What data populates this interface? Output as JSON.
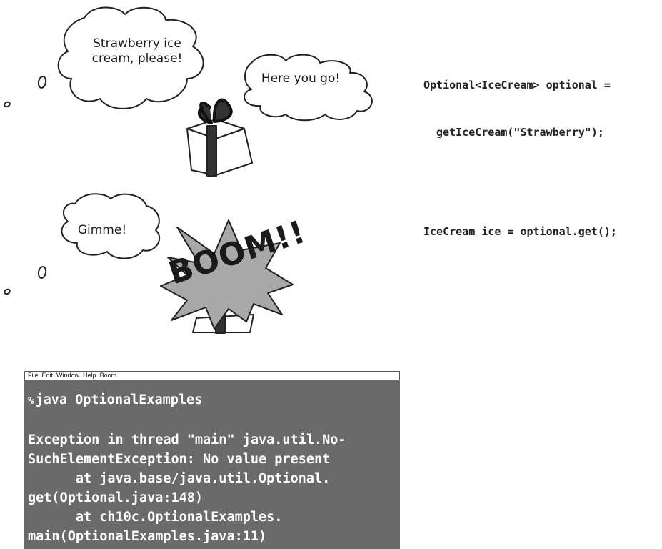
{
  "panel1": {
    "speech_customer": [
      "Strawberry ice",
      "cream, please!"
    ],
    "speech_clerk": "Here you go!",
    "code": [
      "Optional<IceCream> optional =",
      "  getIceCream(\"Strawberry\");"
    ]
  },
  "panel2": {
    "speech_customer": "Gimme!",
    "explosion_text": "BOOM!!",
    "code": "IceCream ice = optional.get();"
  },
  "terminal": {
    "menu": [
      "File",
      "Edit",
      "Window",
      "Help",
      "Boom"
    ],
    "prompt": "%",
    "command": "java OptionalExamples",
    "output": [
      "Exception in thread \"main\" java.util.No-",
      "SuchElementException: No value present",
      "      at java.base/java.util.Optional.",
      "get(Optional.java:148)",
      "      at ch10c.OptionalExamples.",
      "main(OptionalExamples.java:11)"
    ]
  },
  "colors": {
    "terminal_bg": "#6a6a6a",
    "explosion_fill": "#a8a8a8",
    "ribbon": "#333333"
  }
}
